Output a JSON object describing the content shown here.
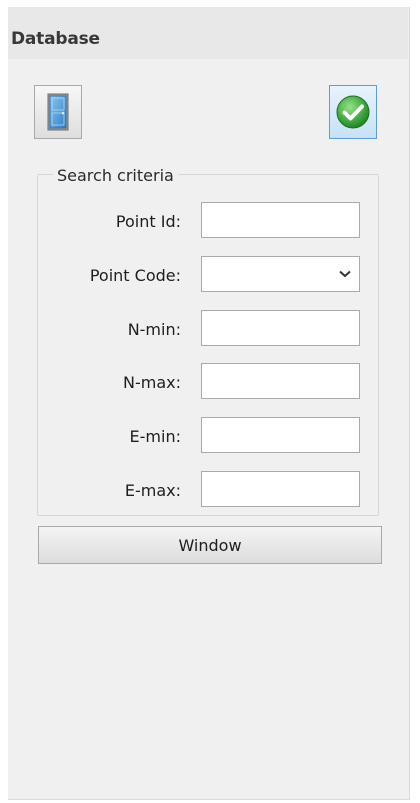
{
  "panel": {
    "title": "Database"
  },
  "toolbar": {
    "exit_icon": "door-exit-icon",
    "confirm_icon": "green-check-icon",
    "confirm_color": "#3fae3f"
  },
  "search": {
    "legend": "Search criteria",
    "fields": {
      "point_id": {
        "label": "Point Id:",
        "value": ""
      },
      "point_code": {
        "label": "Point Code:",
        "value": ""
      },
      "n_min": {
        "label": "N-min:",
        "value": ""
      },
      "n_max": {
        "label": "N-max:",
        "value": ""
      },
      "e_min": {
        "label": "E-min:",
        "value": ""
      },
      "e_max": {
        "label": "E-max:",
        "value": ""
      }
    }
  },
  "window_button": {
    "label": "Window"
  }
}
